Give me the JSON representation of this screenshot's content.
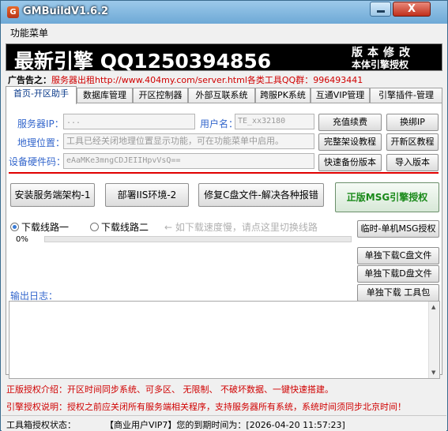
{
  "window": {
    "title": "GMBuildV1.6.2",
    "icon": "app-icon",
    "close_glyph": "X"
  },
  "menu": {
    "label": "功能菜单"
  },
  "banner": {
    "main": "最新引擎 QQ1250394856",
    "right_top": "版本修改",
    "right_bottom": "本体引擎授权"
  },
  "ad": {
    "label": "广告告之：",
    "text": "服务器出租http://www.404my.com/server.html各类工具QQ群：996493441"
  },
  "tabs": [
    {
      "label": "首页-开区助手",
      "active": true
    },
    {
      "label": "数据库管理"
    },
    {
      "label": "开区控制器"
    },
    {
      "label": "外部互联系统"
    },
    {
      "label": "跨服PK系统"
    },
    {
      "label": "互通VIP管理"
    },
    {
      "label": "引擎插件-管理"
    }
  ],
  "form": {
    "server_ip_label": "服务器IP：",
    "server_ip_value": "...",
    "username_label": "用户名：",
    "username_value": "TE_xx32180",
    "geo_label": "地理位置：",
    "geo_value": "工具已经关闭地理位置显示功能，可在功能菜单中启用。",
    "hwid_label": "设备硬件码：",
    "hwid_value": "eAaMKe3mngCDJEIIHpvVsQ=="
  },
  "buttons": {
    "recharge": "充值续费",
    "rebind_ip": "换绑IP",
    "full_tutorial": "完整架设教程",
    "new_server_tutorial": "开新区教程",
    "quick_backup": "快速备份版本",
    "import_version": "导入版本",
    "install_server": "安装服务端架构-1",
    "deploy_iis": "部署IIS环境-2",
    "repair_c": "修复C盘文件-解决各种报错",
    "msg_auth": "正版MSG引擎授权",
    "temp_auth": "临时-单机MSG授权",
    "dl_c": "单独下载C盘文件",
    "dl_d": "单独下载D盘文件",
    "dl_tools": "单独下载 工具包"
  },
  "download": {
    "line1": "下载线路一",
    "line2": "下载线路二",
    "hint": "← 如下载速度慢，请点这里切换线路",
    "progress_text": "0%",
    "progress": 0
  },
  "log": {
    "label": "输出日志："
  },
  "notes": {
    "license": "正版授权介绍：开区时间同步系统、可多区、 无限制、 不破坏数据、一键快速搭建。",
    "engine": "引擎授权说明：授权之前应关闭所有服务端相关程序，支持服务器所有系统，系统时间须同步北京时间！"
  },
  "status": {
    "left": "工具箱授权状态：",
    "right": "【商业用户VIP7】您的到期时间为：[2026-04-20 11:57:23]"
  }
}
